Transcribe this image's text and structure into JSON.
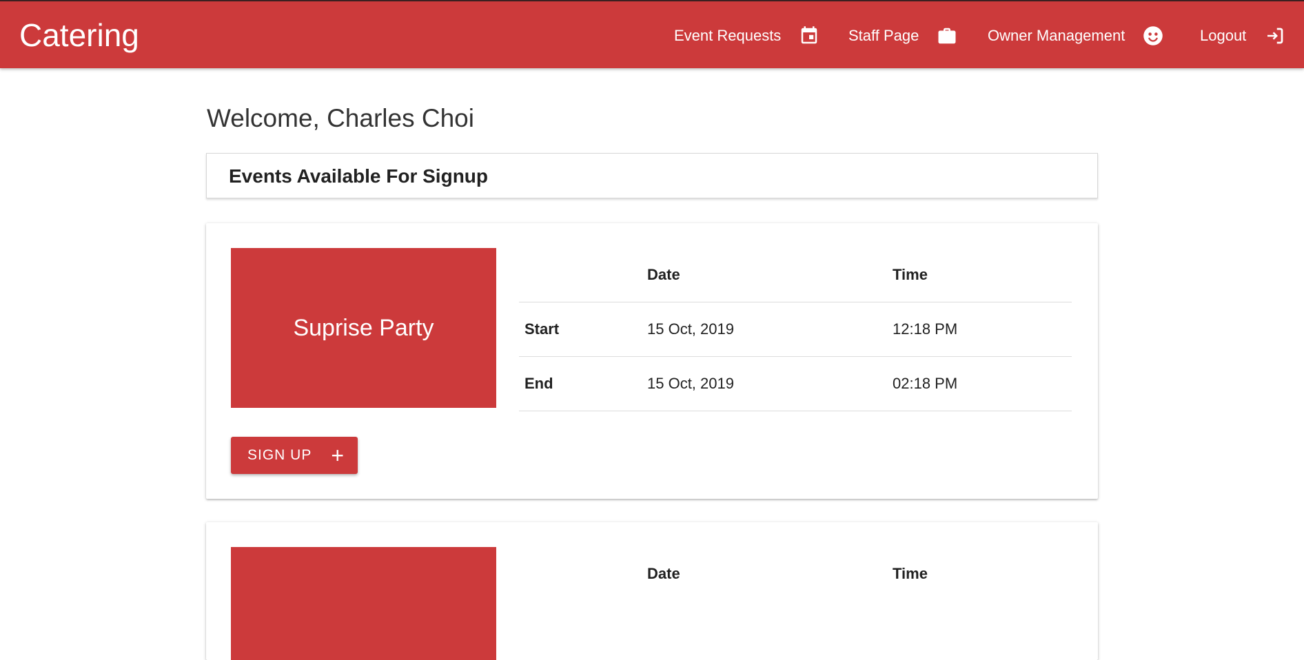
{
  "navbar": {
    "brand": "Catering",
    "items": [
      {
        "label": "Event Requests",
        "icon": "calendar-icon"
      },
      {
        "label": "Staff Page",
        "icon": "briefcase-icon"
      },
      {
        "label": "Owner Management",
        "icon": "user-face-icon"
      },
      {
        "label": "Logout",
        "icon": "logout-icon"
      }
    ],
    "color": "#cc3a3b"
  },
  "welcome": "Welcome, Charles Choi",
  "section_title": "Events Available For Signup",
  "table_headers": {
    "label": "",
    "date": "Date",
    "time": "Time"
  },
  "events": [
    {
      "name": "Suprise Party",
      "start_label": "Start",
      "start_date": "15 Oct, 2019",
      "start_time": "12:18 PM",
      "end_label": "End",
      "end_date": "15 Oct, 2019",
      "end_time": "02:18 PM",
      "button_label": "SIGN UP",
      "button_icon": "plus-icon"
    }
  ],
  "plus_glyph": "+"
}
